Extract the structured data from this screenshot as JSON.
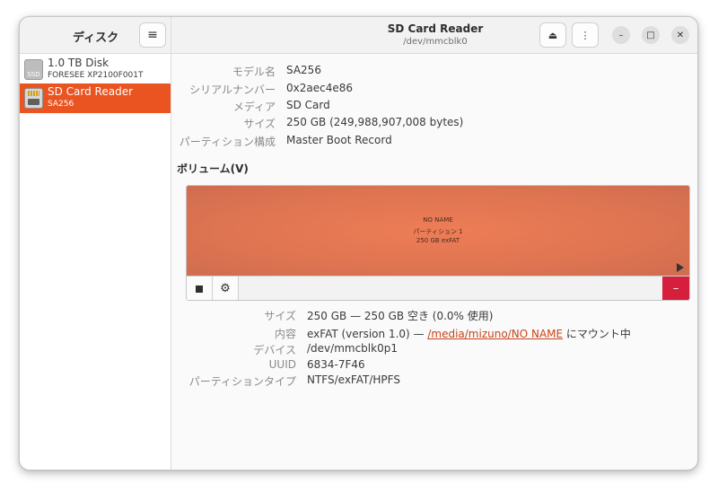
{
  "sidebar": {
    "title": "ディスク",
    "menu_icon": "≡",
    "disks": [
      {
        "name": "1.0 TB Disk",
        "model": "FORESEE XP2100F001T",
        "icon_text": "SSD",
        "selected": false
      },
      {
        "name": "SD Card Reader",
        "model": "SA256",
        "selected": true
      }
    ]
  },
  "header": {
    "title": "SD Card Reader",
    "subtitle": "/dev/mmcblk0",
    "eject_icon": "⏏",
    "more_icon": "⋮",
    "minimize_icon": "–",
    "maximize_icon": "□",
    "close_icon": "✕"
  },
  "drive_info": [
    {
      "label": "モデル名",
      "value": "SA256"
    },
    {
      "label": "シリアルナンバー",
      "value": "0x2aec4e86"
    },
    {
      "label": "メディア",
      "value": "SD Card"
    },
    {
      "label": "サイズ",
      "value": "250 GB (249,988,907,008 bytes)"
    },
    {
      "label": "パーティション構成",
      "value": "Master Boot Record"
    }
  ],
  "volumes": {
    "title": "ボリューム(V)",
    "partition": {
      "name": "NO NAME",
      "label": "パーティション 1",
      "summary": "250 GB exFAT"
    },
    "remove_icon": "–",
    "gear_icon": "⚙"
  },
  "volume_info": {
    "size_label": "サイズ",
    "size_value": "250 GB — 250 GB 空き (0.0% 使用)",
    "content_label": "内容",
    "content_prefix": "exFAT (version 1.0) — ",
    "content_link": "/media/mizuno/NO NAME",
    "content_suffix": " にマウント中",
    "device_label": "デバイス",
    "device_value": "/dev/mmcblk0p1",
    "uuid_label": "UUID",
    "uuid_value": "6834-7F46",
    "type_label": "パーティションタイプ",
    "type_value": "NTFS/exFAT/HPFS"
  },
  "colors": {
    "accent": "#e95420",
    "partition": "#e47a55",
    "destructive": "#d61f3d"
  }
}
